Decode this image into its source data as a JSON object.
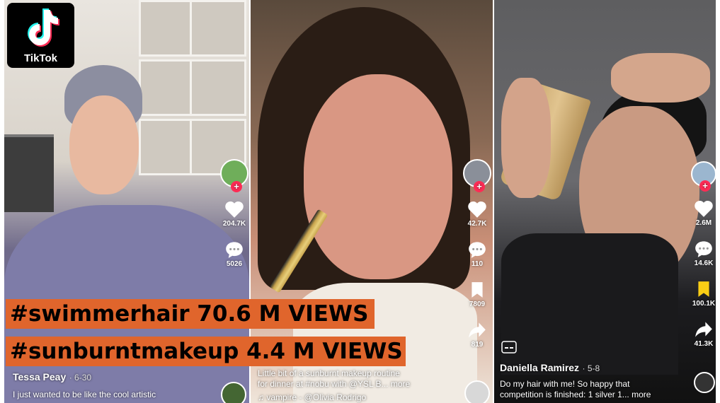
{
  "logo": {
    "text": "TikTok"
  },
  "banners": [
    {
      "text": "#swimmerhair 70.6 M VIEWS"
    },
    {
      "text": "#sunburntmakeup 4.4 M VIEWS"
    }
  ],
  "videos": [
    {
      "username": "Tessa Peay",
      "date": "· 6-30",
      "description": "I just wanted to be like the cool artistic",
      "likes": "204.7K",
      "comments": "5026",
      "avatar_color": "#6fae5a"
    },
    {
      "username": "",
      "description_line1": "Little bit of a sunburnt makeup routine",
      "description_line2": "for dinner at #nobu with @YSL B... more",
      "music": "♫ vampire - @Olivia Rodrigo",
      "likes": "42.7K",
      "comments": "110",
      "saves": "7809",
      "shares": "819",
      "avatar_color": "#8a8f99"
    },
    {
      "username": "Daniella Ramirez",
      "date": "· 5-8",
      "description_line1": "Do my hair with me! So happy that",
      "description_line2": "competition is finished: 1 silver 1... more",
      "likes": "2.6M",
      "comments": "14.6K",
      "saves": "100.1K",
      "shares": "41.3K",
      "avatar_color": "#9bb6cf"
    }
  ],
  "colors": {
    "banner": "#e0652c",
    "tiktok_red": "#fe2c55",
    "tiktok_cyan": "#25f4ee",
    "save_yellow": "#face15"
  }
}
